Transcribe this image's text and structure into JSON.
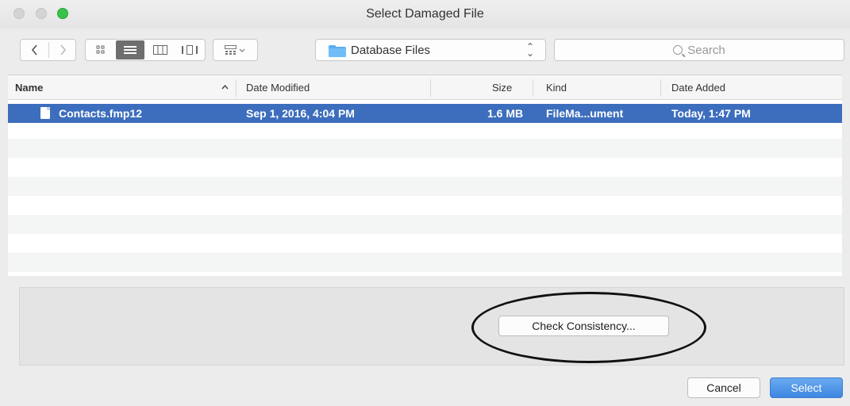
{
  "window": {
    "title": "Select Damaged File"
  },
  "toolbar": {
    "path_label": "Database Files",
    "search_placeholder": "Search",
    "accent_color": "#3d6ebe"
  },
  "columns": [
    {
      "label": "Name",
      "sort": "ascending"
    },
    {
      "label": "Date Modified"
    },
    {
      "label": "Size"
    },
    {
      "label": "Kind"
    },
    {
      "label": "Date Added"
    }
  ],
  "files": [
    {
      "name": "Contacts.fmp12",
      "date_modified": "Sep 1, 2016, 4:04 PM",
      "size": "1.6 MB",
      "kind": "FileMa...ument",
      "date_added": "Today, 1:47 PM",
      "selected": true
    }
  ],
  "accessory": {
    "check_button": "Check Consistency..."
  },
  "footer": {
    "cancel_label": "Cancel",
    "select_label": "Select"
  }
}
